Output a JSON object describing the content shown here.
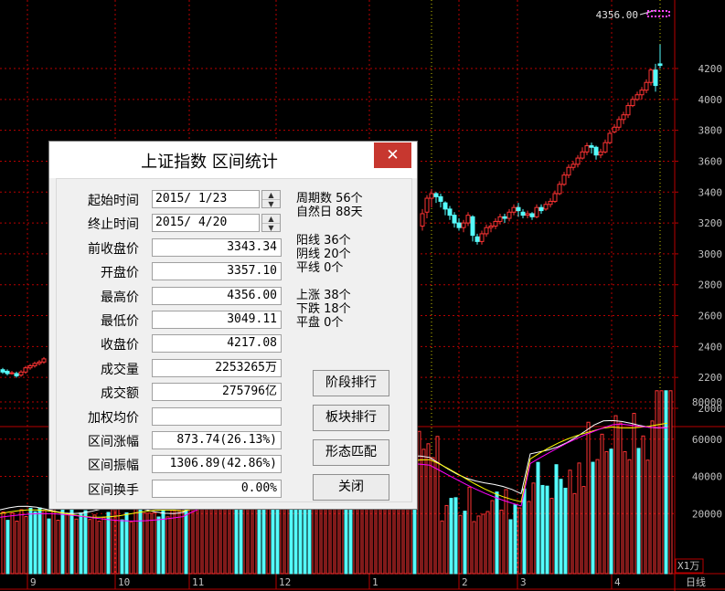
{
  "chart": {
    "price_axis_labels": [
      "4200",
      "4000",
      "3800",
      "3600",
      "3400",
      "3200",
      "3000",
      "2800",
      "2600",
      "2400",
      "2200",
      "2000"
    ],
    "volume_axis_labels": [
      "80000",
      "60000",
      "40000",
      "20000"
    ],
    "volume_unit": "X1万",
    "period": "日线",
    "month_labels": [
      "9",
      "10",
      "11",
      "12",
      "1",
      "2",
      "3",
      "4"
    ],
    "max_marker": "4356.00",
    "up_color": "#ff3333",
    "down_color": "#54fcfc",
    "axis_color": "#b80000",
    "text_color": "#c0c0c0"
  },
  "dialog": {
    "title": "上证指数 区间统计",
    "close_glyph": "✕",
    "fields": [
      {
        "label": "起始时间",
        "value": "2015/ 1/23"
      },
      {
        "label": "终止时间",
        "value": "2015/ 4/20"
      },
      {
        "label": "前收盘价",
        "value": "3343.34"
      },
      {
        "label": "开盘价",
        "value": "3357.10"
      },
      {
        "label": "最高价",
        "value": "4356.00"
      },
      {
        "label": "最低价",
        "value": "3049.11"
      },
      {
        "label": "收盘价",
        "value": "4217.08"
      },
      {
        "label": "成交量",
        "value": "2253265万"
      },
      {
        "label": "成交额",
        "value": "275796亿"
      },
      {
        "label": "加权均价",
        "value": ""
      },
      {
        "label": "区间涨幅",
        "value": "873.74(26.13%)"
      },
      {
        "label": "区间振幅",
        "value": "1306.89(42.86%)"
      },
      {
        "label": "区间换手",
        "value": "0.00%"
      }
    ],
    "stats": {
      "period_days": "周期数  56个",
      "natural_days": "自然日  88天",
      "yang": "阳线  36个",
      "yin": "阴线  20个",
      "flat_line": "平线  0个",
      "up": "上涨  38个",
      "down": "下跌  18个",
      "flat": "平盘  0个"
    },
    "buttons": {
      "stage_rank": "阶段排行",
      "sector_rank": "板块排行",
      "pattern_match": "形态匹配",
      "close": "关闭"
    }
  }
}
